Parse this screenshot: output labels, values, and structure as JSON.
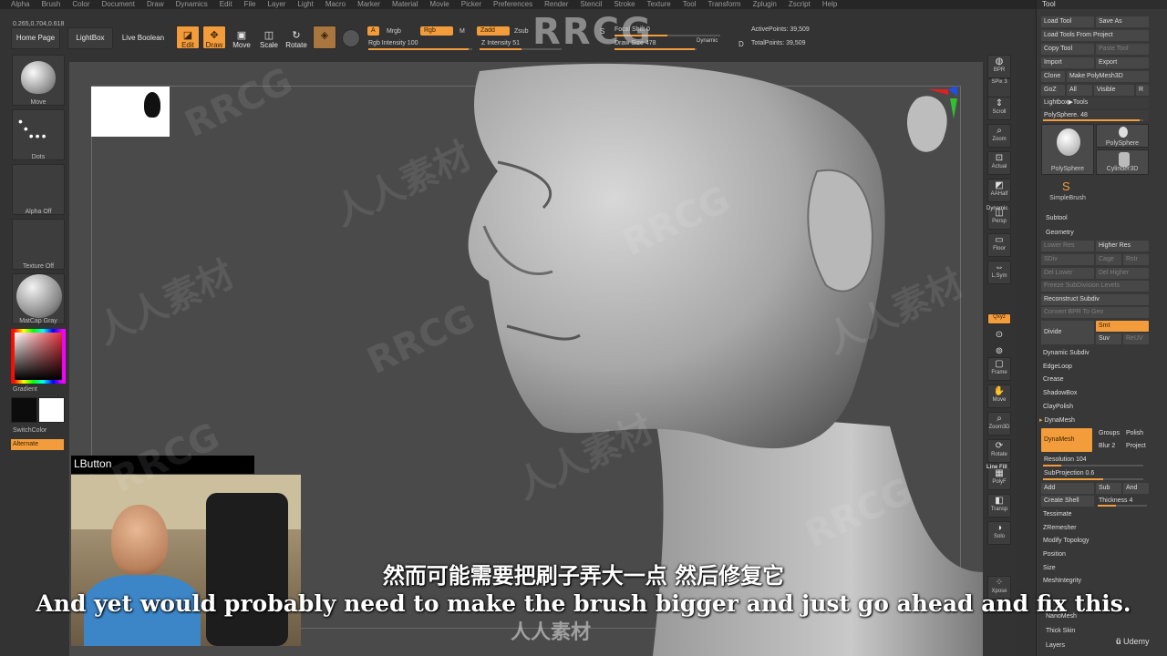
{
  "menu": [
    "Alpha",
    "Brush",
    "Color",
    "Document",
    "Draw",
    "Dynamics",
    "Edit",
    "File",
    "Layer",
    "Light",
    "Macro",
    "Marker",
    "Material",
    "Movie",
    "Picker",
    "Preferences",
    "Render",
    "Stencil",
    "Stroke",
    "Texture",
    "Tool",
    "Transform",
    "Zplugin",
    "Zscript",
    "Help"
  ],
  "coords": "0.265,0.704,0.618",
  "toolbar": {
    "home_page": "Home Page",
    "lightbox": "LightBox",
    "live_boolean": "Live Boolean",
    "edit": "Edit",
    "draw": "Draw",
    "move": "Move",
    "scale": "Scale",
    "rotate": "Rotate",
    "a_label": "A",
    "mrgb": "Mrgb",
    "rgb": "Rgb",
    "m": "M",
    "zadd": "Zadd",
    "zsub": "Zsub",
    "rgb_intensity": "Rgb Intensity 100",
    "z_intensity": "Z Intensity 51",
    "focal_shift": "Focal Shift 0",
    "draw_size": "Draw Size 478",
    "dynamic": "Dynamic",
    "active_points": "ActivePoints: 39,509",
    "total_points": "TotalPoints: 39,509",
    "s_label": "S",
    "d_label": "D"
  },
  "left": {
    "move": "Move",
    "dots": "Dots",
    "alpha_off": "Alpha Off",
    "texture_off": "Texture Off",
    "matcap": "MatCap Gray",
    "gradient": "Gradient",
    "switch_color": "SwitchColor",
    "alternate": "Alternate"
  },
  "shelf": [
    "BPR",
    "SPix 3",
    "Scroll",
    "Zoom",
    "Actual",
    "AAHalf",
    "Persp",
    "Floor",
    "L.Sym",
    "",
    "Qxyz",
    "",
    "",
    "Frame",
    "Move",
    "Zoom3D",
    "Rotate",
    "PolyF",
    "Transp",
    "Solo",
    "Xpose"
  ],
  "shelf_extra": {
    "dynamic": "Dynamic",
    "line_fill": "Line Fill"
  },
  "tool": {
    "header": "Tool",
    "load_tool": "Load Tool",
    "save_as": "Save As",
    "load_from_project": "Load Tools From Project",
    "copy_tool": "Copy Tool",
    "paste_tool": "Paste Tool",
    "import": "Import",
    "export": "Export",
    "clone": "Clone",
    "make_polymesh": "Make PolyMesh3D",
    "goz": "GoZ",
    "all": "All",
    "visible": "Visible",
    "r": "R",
    "lightbox_tools": "Lightbox▶Tools",
    "polysphere_slider": "PolySphere. 48",
    "thumbs": [
      "PolySphere",
      "PolySphere",
      "Cylinder3D",
      "SimpleBrush"
    ],
    "subtool": "Subtool",
    "geometry": "Geometry",
    "lower_res": "Lower Res",
    "higher_res": "Higher Res",
    "sdiv": "SDiv",
    "cage": "Cage",
    "rstr": "Rstr",
    "del_lower": "Del Lower",
    "del_higher": "Del Higher",
    "freeze_subdiv": "Freeze SubDivision Levels",
    "reconstruct": "Reconstruct Subdiv",
    "convert_bpr": "Convert BPR To Geo",
    "divide": "Divide",
    "smt": "Smt",
    "suv": "Suv",
    "reuv": "ReUV",
    "items": [
      "Dynamic Subdiv",
      "EdgeLoop",
      "Crease",
      "ShadowBox",
      "ClayPolish"
    ],
    "dynamesh_section": "DynaMesh",
    "dynamesh_btn": "DynaMesh",
    "groups": "Groups",
    "polish": "Polish",
    "blur": "Blur 2",
    "project": "Project",
    "resolution": "Resolution 104",
    "subprojection": "SubProjection 0.6",
    "add": "Add",
    "sub": "Sub",
    "and": "And",
    "create_shell": "Create Shell",
    "thickness": "Thickness 4",
    "items2": [
      "Tessimate",
      "ZRemesher",
      "Modify Topology",
      "Position",
      "Size",
      "MeshIntegrity"
    ],
    "items3": [
      "NanoMesh",
      "Thick Skin",
      "Layers"
    ]
  },
  "cam_label": "LButton",
  "subtitle_cn": "然而可能需要把刷子弄大一点 然后修复它",
  "subtitle_en": "And yet would probably need to make the brush bigger and just go ahead and fix this.",
  "watermarks": [
    "RRCG",
    "人人素材"
  ],
  "logo_text": "RRCG",
  "bottom_watermark": "人人素材",
  "udemy": "Udemy",
  "colors": {
    "accent": "#f39c3c",
    "bg": "#323232",
    "viewport": "#4a4a4a"
  }
}
